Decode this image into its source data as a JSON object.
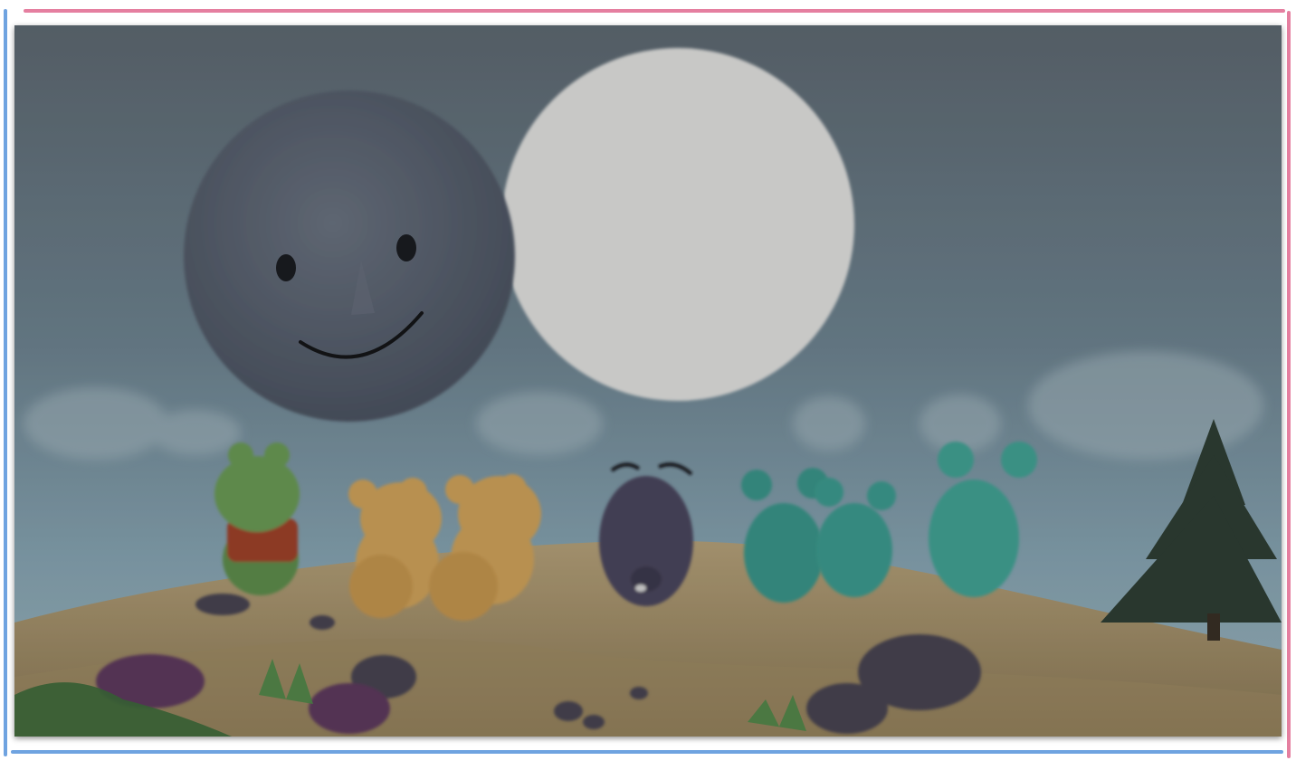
{
  "scene": {
    "description_visible_text": [],
    "colors": {
      "frame_top": "#e57fa0",
      "frame_right": "#e57fa0",
      "frame_left": "#6fa3e0",
      "frame_bottom": "#6fa3e0",
      "sky_top": "#5f6b75",
      "sky_bottom": "#8fb0c0",
      "sun": "#e9e9e9",
      "moon": "#5b6472",
      "ground": "#b9a47a",
      "frog": "#6fa05a",
      "bears": "#d8a85a",
      "purple_creature": "#4e4a63",
      "teal_creatures": "#3e9c90",
      "tree": "#2e3d33"
    },
    "icons": [
      "moon-face-icon",
      "sun-icon",
      "pine-tree-icon"
    ]
  }
}
